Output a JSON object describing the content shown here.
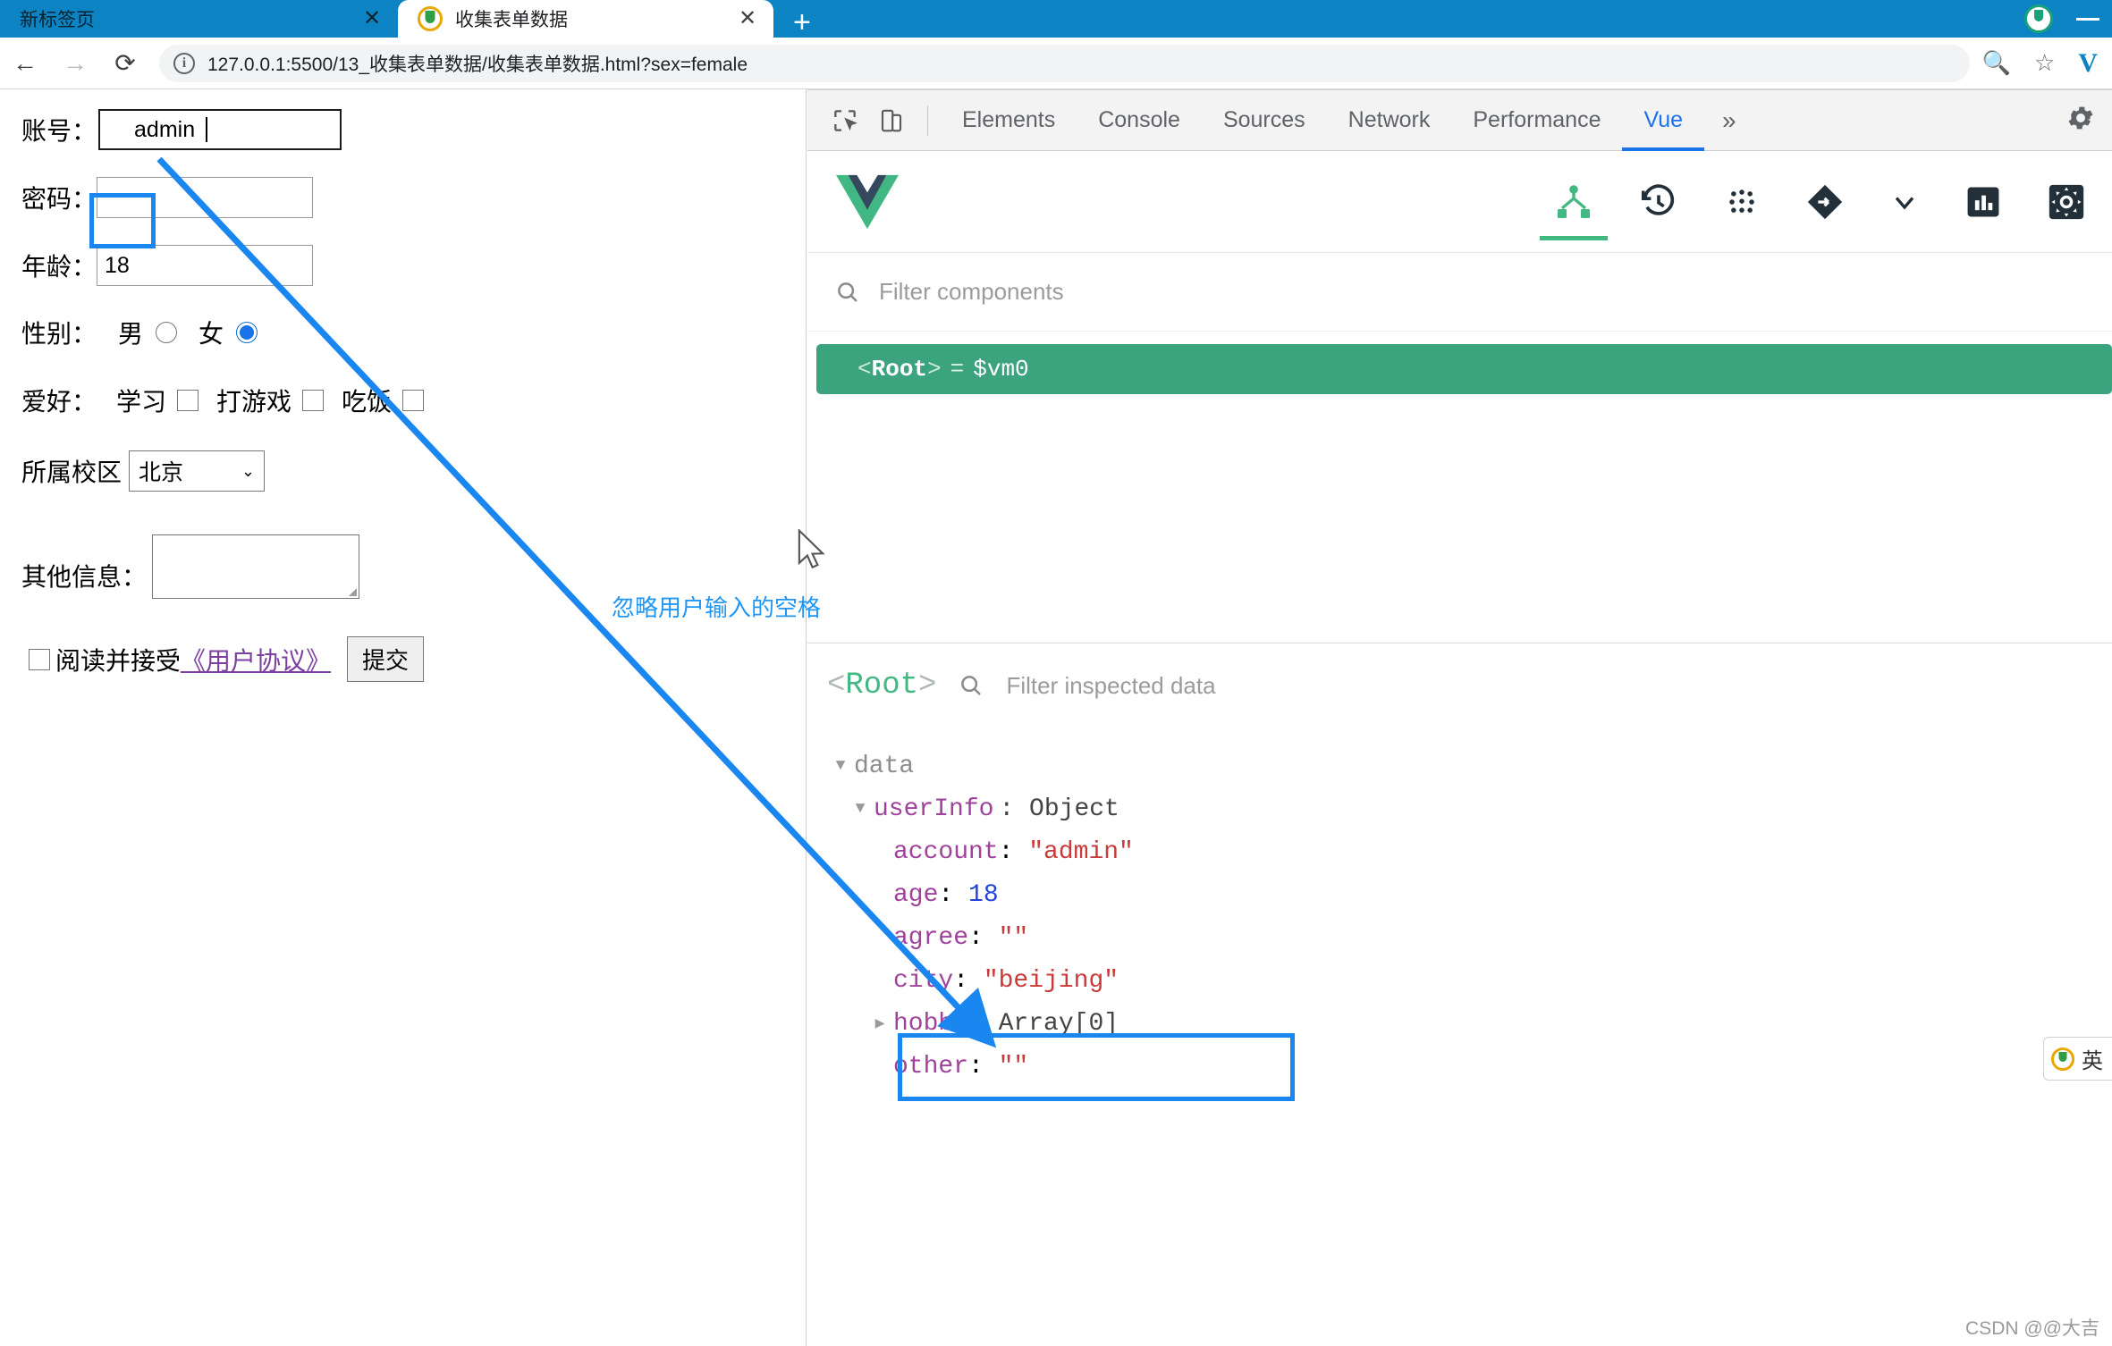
{
  "browser": {
    "tabs": [
      {
        "title": "新标签页",
        "active": false,
        "close_label": "✕",
        "has_favicon": false
      },
      {
        "title": "收集表单数据",
        "active": true,
        "close_label": "✕",
        "has_favicon": true
      }
    ],
    "new_tab_label": "+",
    "nav": {
      "back": "←",
      "forward": "→",
      "reload": "⟳"
    },
    "url": "127.0.0.1:5500/13_收集表单数据/收集表单数据.html?sex=female",
    "info_icon_label": "i",
    "zoom_icon": "search-plus-icon",
    "bookmark_icon": "star-icon",
    "profile_initial": "V",
    "minimize_label": "—"
  },
  "form": {
    "account": {
      "label": "账号：",
      "value": "admin",
      "leading_space": true,
      "focused": true
    },
    "password": {
      "label": "密码：",
      "value": ""
    },
    "age": {
      "label": "年龄：",
      "value": "18"
    },
    "gender": {
      "label": "性别：",
      "options": [
        {
          "label": "男",
          "checked": false
        },
        {
          "label": "女",
          "checked": true
        }
      ]
    },
    "hobby": {
      "label": "爱好：",
      "options": [
        {
          "label": "学习",
          "checked": false
        },
        {
          "label": "打游戏",
          "checked": false
        },
        {
          "label": "吃饭",
          "checked": false
        }
      ]
    },
    "campus": {
      "label": "所属校区",
      "value": "北京",
      "arrow": "⌄"
    },
    "other": {
      "label": "其他信息：",
      "value": ""
    },
    "agreement": {
      "checked": false,
      "prefix": "阅读并接受",
      "link_text": "《用户协议》"
    },
    "submit": {
      "label": "提交"
    }
  },
  "annotation": {
    "text": "忽略用户输入的空格",
    "color": "#2196f3"
  },
  "devtools": {
    "tools": [
      "inspect-element-icon",
      "device-toolbar-icon"
    ],
    "tabs": [
      {
        "label": "Elements",
        "active": false
      },
      {
        "label": "Console",
        "active": false
      },
      {
        "label": "Sources",
        "active": false
      },
      {
        "label": "Network",
        "active": false
      },
      {
        "label": "Performance",
        "active": false
      },
      {
        "label": "Vue",
        "active": true
      }
    ],
    "more_label": "»",
    "settings_icon": "gear-icon",
    "vue": {
      "logo": "vue-logo",
      "actions": [
        {
          "icon": "components-tree-icon",
          "active": true
        },
        {
          "icon": "timeline-history-icon",
          "active": false
        },
        {
          "icon": "vuex-dots-icon",
          "active": false
        },
        {
          "icon": "router-diamond-icon",
          "active": false
        },
        {
          "icon": "chevron-down-icon",
          "active": false
        },
        {
          "icon": "performance-bars-icon",
          "active": false
        },
        {
          "icon": "settings-gear-icon",
          "active": false
        }
      ],
      "filter_placeholder": "Filter components",
      "component_row": {
        "open_angle": "<",
        "name": "Root",
        "close_angle": ">",
        "equals": "=",
        "instance": "$vm0",
        "selected": true
      },
      "inspected": {
        "root_open": "<",
        "root_name": "Root",
        "root_close": ">",
        "filter_placeholder": "Filter inspected data",
        "tree": [
          {
            "indent": 0,
            "triangle": "▼",
            "key": "data",
            "key_style": "grey",
            "value": "",
            "value_style": ""
          },
          {
            "indent": 1,
            "triangle": "▼",
            "key": "userInfo",
            "key_style": "prop",
            "value": "Object",
            "value_style": "type",
            "highlighted": true
          },
          {
            "indent": 2,
            "triangle": "",
            "key": "account",
            "key_style": "prop",
            "value": "\"admin\"",
            "value_style": "str",
            "highlighted": true
          },
          {
            "indent": 2,
            "triangle": "",
            "key": "age",
            "key_style": "prop",
            "value": "18",
            "value_style": "num"
          },
          {
            "indent": 2,
            "triangle": "",
            "key": "agree",
            "key_style": "prop",
            "value": "\"\"",
            "value_style": "str"
          },
          {
            "indent": 2,
            "triangle": "",
            "key": "city",
            "key_style": "prop",
            "value": "\"beijing\"",
            "value_style": "str"
          },
          {
            "indent": 2,
            "triangle": "▶",
            "key": "hobby",
            "key_style": "prop",
            "value": "Array[0]",
            "value_style": "type"
          },
          {
            "indent": 2,
            "triangle": "",
            "key": "other",
            "key_style": "prop",
            "value": "\"\"",
            "value_style": "str"
          }
        ]
      }
    }
  },
  "ime": {
    "label": "英"
  },
  "watermark": "CSDN @@大吉"
}
